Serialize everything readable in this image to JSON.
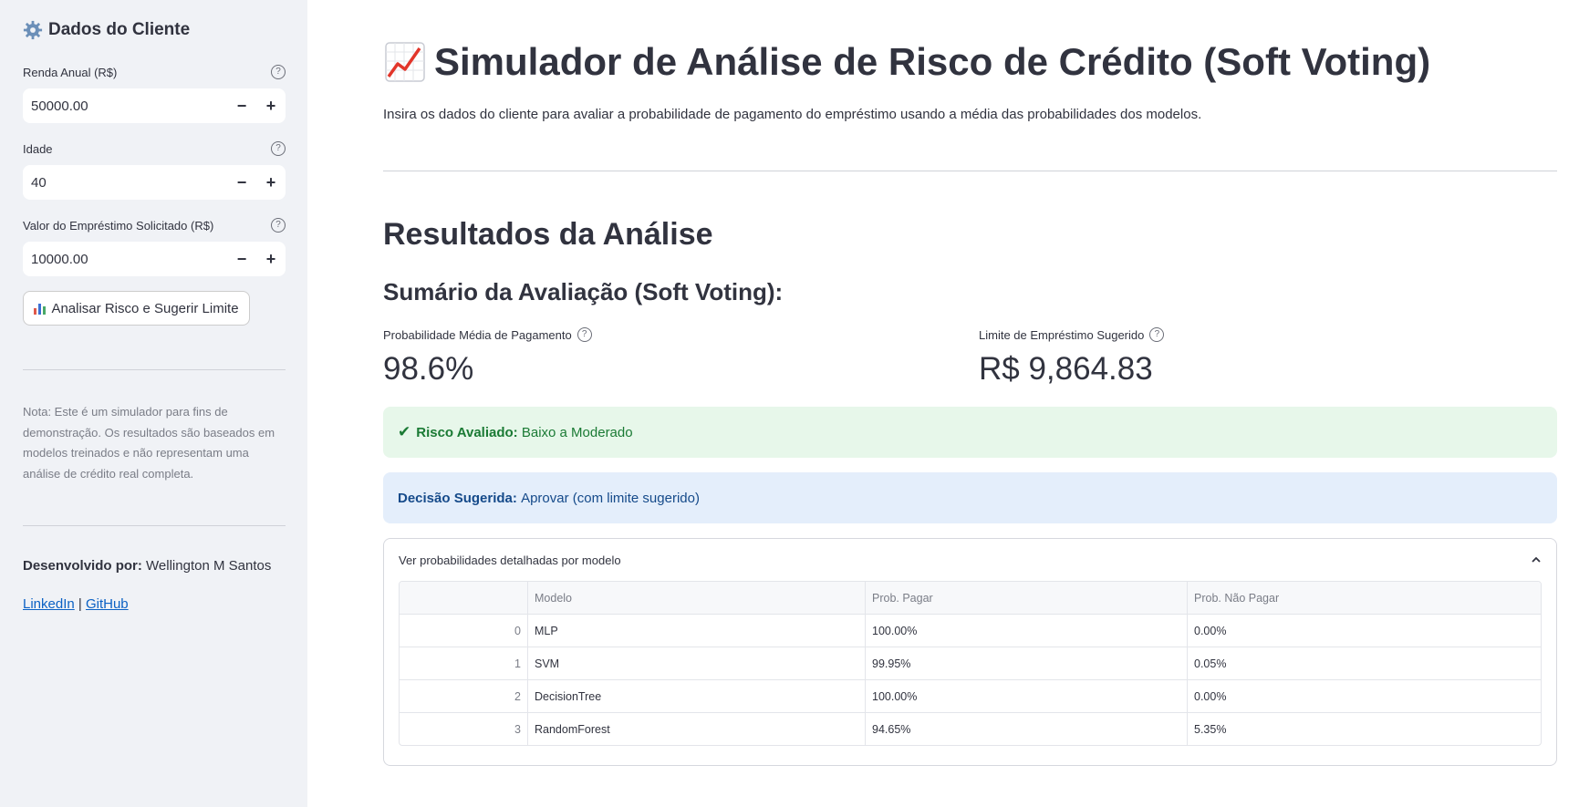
{
  "sidebar": {
    "title": "Dados do Cliente",
    "fields": [
      {
        "label": "Renda Anual (R$)",
        "value": "50000.00"
      },
      {
        "label": "Idade",
        "value": "40"
      },
      {
        "label": "Valor do Empréstimo Solicitado (R$)",
        "value": "10000.00"
      }
    ],
    "analyze_button": "Analisar Risco e Sugerir Limite",
    "note": "Nota: Este é um simulador para fins de demonstração. Os resultados são baseados em modelos treinados e não representam uma análise de crédito real completa.",
    "dev_label": "Desenvolvido por:",
    "dev_name": "Wellington M Santos",
    "link_linkedin": "LinkedIn",
    "link_separator": "|",
    "link_github": "GitHub"
  },
  "main": {
    "title": "Simulador de Análise de Risco de Crédito (Soft Voting)",
    "subtitle": "Insira os dados do cliente para avaliar a probabilidade de pagamento do empréstimo usando a média das probabilidades dos modelos.",
    "results_heading": "Resultados da Análise",
    "summary_heading": "Sumário da Avaliação (Soft Voting):",
    "metrics": [
      {
        "label": "Probabilidade Média de Pagamento",
        "value": "98.6%"
      },
      {
        "label": "Limite de Empréstimo Sugerido",
        "value": "R$ 9,864.83"
      }
    ],
    "risk_alert": {
      "label": "Risco Avaliado:",
      "value": "Baixo a Moderado"
    },
    "decision_alert": {
      "label": "Decisão Sugerida:",
      "value": "Aprovar (com limite sugerido)"
    },
    "expander_title": "Ver probabilidades detalhadas por modelo",
    "table": {
      "columns": [
        "Modelo",
        "Prob. Pagar",
        "Prob. Não Pagar"
      ],
      "rows": [
        {
          "idx": "0",
          "model": "MLP",
          "pay": "100.00%",
          "nopay": "0.00%"
        },
        {
          "idx": "1",
          "model": "SVM",
          "pay": "99.95%",
          "nopay": "0.05%"
        },
        {
          "idx": "2",
          "model": "DecisionTree",
          "pay": "100.00%",
          "nopay": "0.00%"
        },
        {
          "idx": "3",
          "model": "RandomForest",
          "pay": "94.65%",
          "nopay": "5.35%"
        }
      ]
    }
  },
  "colors": {
    "success_bg": "#e7f7ea",
    "success_text": "#1a7a34",
    "info_bg": "#e4eefb",
    "info_text": "#154a8a",
    "sidebar_bg": "#f0f2f6"
  },
  "icons": {
    "sidebar_title": "gear-icon",
    "main_title": "chart-increasing-icon",
    "button": "bar-chart-icon",
    "success": "check-icon"
  }
}
